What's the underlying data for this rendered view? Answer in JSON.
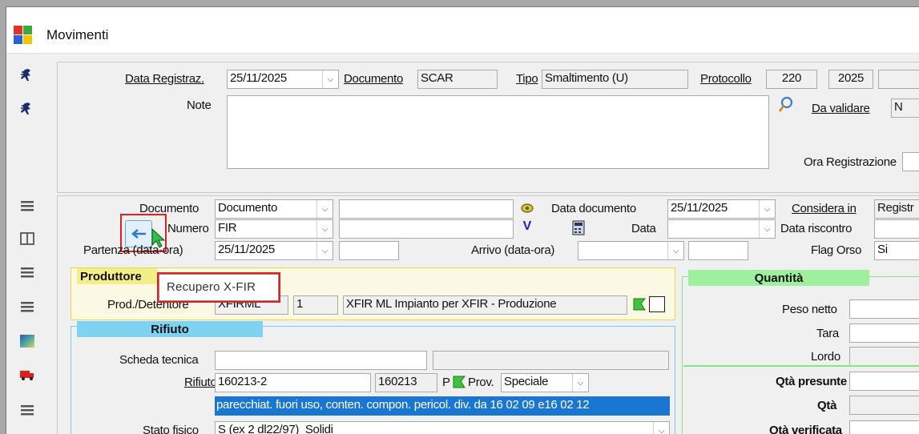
{
  "window": {
    "title": "Movimenti"
  },
  "top": {
    "data_registraz_label": "Data Registraz.",
    "data_registraz_value": "25/11/2025",
    "documento_label": "Documento",
    "documento_value": "SCAR",
    "tipo_label": "Tipo",
    "tipo_value": "Smaltimento (U)",
    "protocollo_label": "Protocollo",
    "protocollo_number": "220",
    "protocollo_year": "2025",
    "note_label": "Note",
    "note_value": "",
    "da_validare_label": "Da validare",
    "da_validare_value": "N",
    "ora_registrazione_label": "Ora Registrazione"
  },
  "doc": {
    "documento_label": "Documento",
    "documento_value": "Documento",
    "documento_text": "",
    "data_documento_label": "Data documento",
    "data_documento_value": "25/11/2025",
    "considera_in_label": "Considera in",
    "considera_in_value": "Registr",
    "numero_label": "Numero",
    "numero_value": "FIR",
    "numero_text": "",
    "v_button": "V",
    "data_label": "Data",
    "data_value": "",
    "data_riscontro_label": "Data riscontro",
    "partenza_label": "Partenza (data-ora)",
    "partenza_value": "25/11/2025",
    "arrivo_label": "Arrivo (data-ora)",
    "flag_orso_label": "Flag Orso",
    "flag_orso_value": "Si",
    "tooltip": "Recupero X-FIR"
  },
  "produttore": {
    "header": "Produttore",
    "prod_label": "Prod./Detentore",
    "prod_code": "XFIRML",
    "prod_num": "1",
    "prod_desc": "XFIR ML Impianto per XFIR - Produzione"
  },
  "rifiuto": {
    "header": "Rifiuto",
    "scheda_label": "Scheda tecnica",
    "rifiuto_label": "Rifiuto",
    "rifiuto_code": "160213-2",
    "rifiuto_cer": "160213",
    "rifiuto_p": "P",
    "prov_label": "Prov.",
    "prov_value": "Speciale",
    "rifiuto_desc": "parecchiat. fuori uso, conten. compon. pericol. div. da 16 02 09 e16 02 12",
    "stato_label": "Stato fisico",
    "stato_value": "S (ex 2 dl22/97)  Solidi"
  },
  "quantita": {
    "header": "Quantità",
    "peso_netto_label": "Peso netto",
    "tara_label": "Tara",
    "lordo_label": "Lordo",
    "qta_presunte_label": "Qtà presunte",
    "qta_label": "Qtà",
    "qta_verificata_label": "Qtà verificata"
  },
  "colors": {
    "produttore_border": "#e8d84a",
    "produttore_header": "#f3ee8a",
    "rifiuto_border": "#7ec8ee",
    "rifiuto_header": "#7fd3f2",
    "quantita_border": "#8ce08c",
    "quantita_header": "#9ef09e",
    "selection": "#1976d2",
    "highlight": "#e32020"
  }
}
